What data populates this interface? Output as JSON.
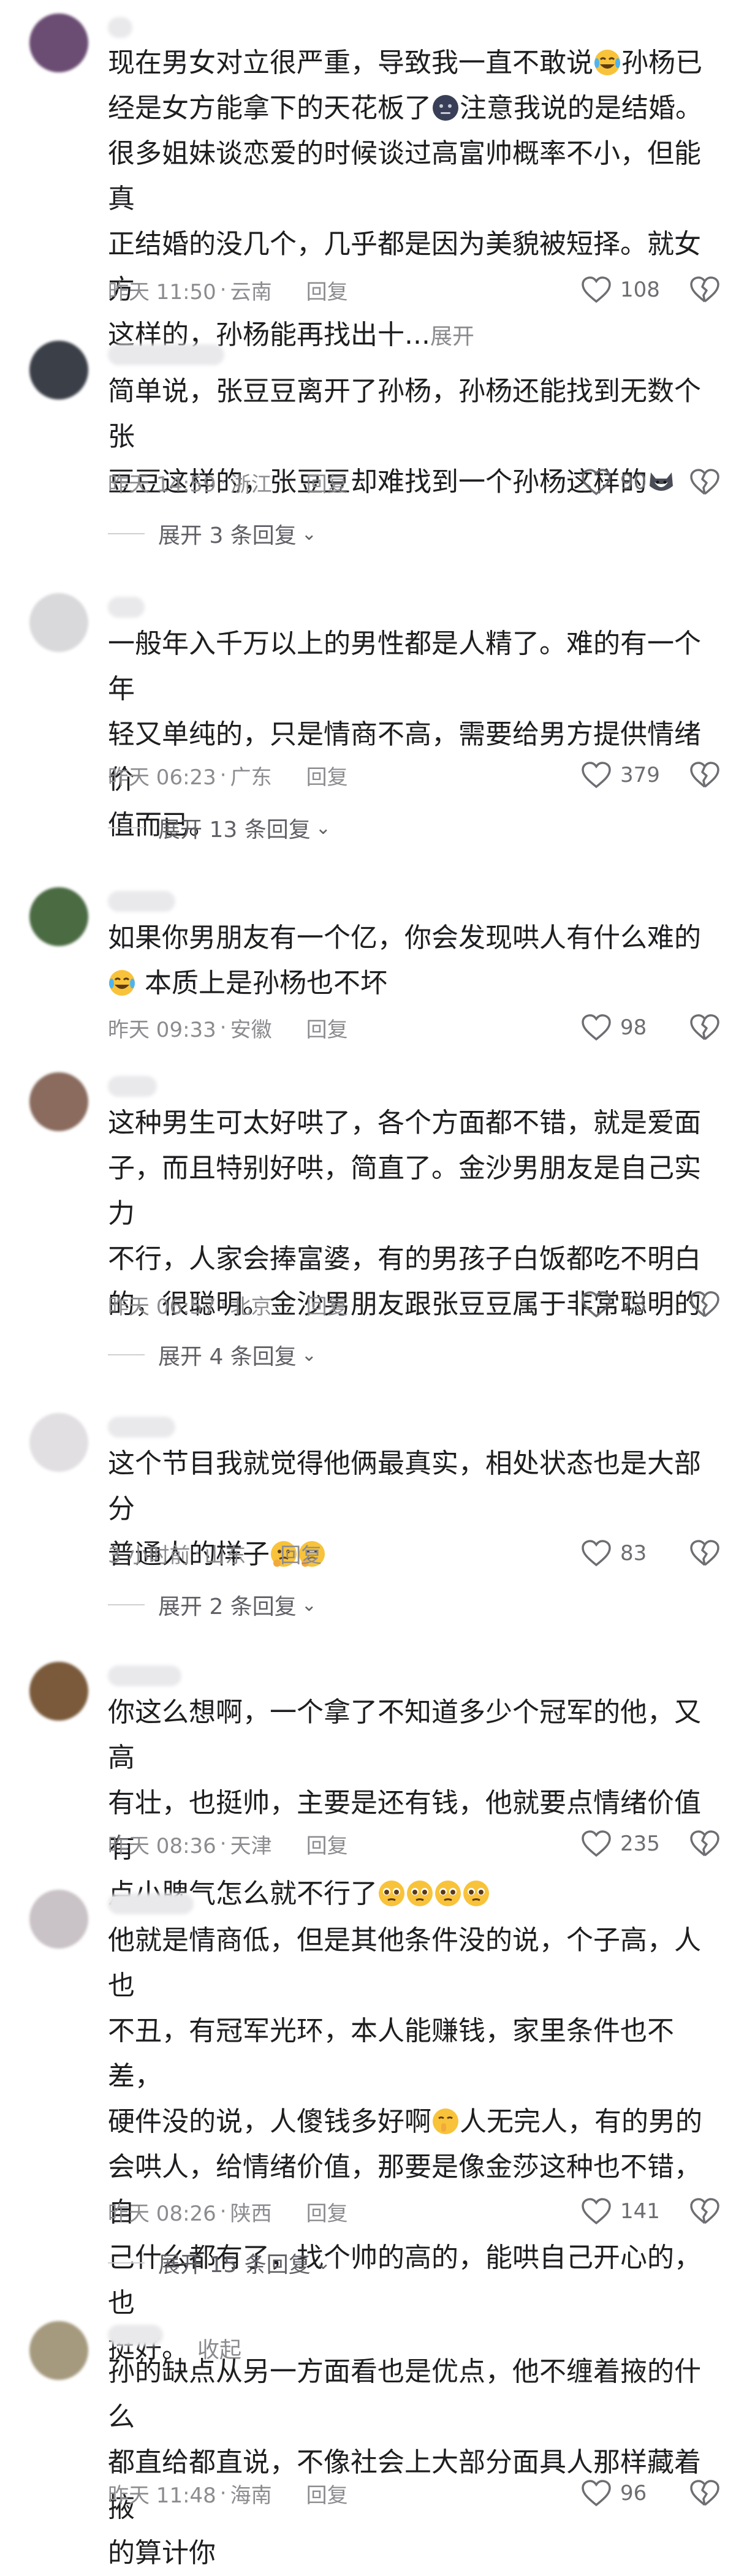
{
  "comments": [
    {
      "avatar_color": "#6b4c73",
      "text_lines": [
        "现在男女对立很严重，导致我一直不敢说",
        "孙杨已",
        "经是女方能拿下的天花板了",
        "注意我说的是结婚。",
        "很多姐妹谈恋爱的时候谈过高富帅概率不小，但能真",
        "正结婚的没几个，几乎都是因为美貌被短择。就女方",
        "这样的，孙杨能再找出十..."
      ],
      "more_label": "展开",
      "time": "昨天 11:50",
      "location": "云南",
      "reply_label": "回复",
      "likes": "108"
    },
    {
      "avatar_color": "#3b3f48",
      "text_lines": [
        "简单说，张豆豆离开了孙杨，孙杨还能找到无数个张",
        "豆豆这样的，张豆豆却难找到一个孙杨这样的"
      ],
      "time": "昨天 14:59",
      "location": "浙江",
      "reply_label": "回复",
      "likes": "90",
      "expand_label": "展开 3 条回复"
    },
    {
      "avatar_color": "#d9d9dc",
      "text_lines": [
        "一般年入千万以上的男性都是人精了。难的有一个年",
        "轻又单纯的，只是情商不高，需要给男方提供情绪价",
        "值而已。"
      ],
      "time": "昨天 06:23",
      "location": "广东",
      "reply_label": "回复",
      "likes": "379",
      "expand_label": "展开 13 条回复"
    },
    {
      "avatar_color": "#4b6b43",
      "text_lines": [
        "如果你男朋友有一个亿，你会发现哄人有什么难的",
        "本质上是孙杨也不坏"
      ],
      "time": "昨天 09:33",
      "location": "安徽",
      "reply_label": "回复",
      "likes": "98"
    },
    {
      "avatar_color": "#8a6b5e",
      "text_lines": [
        "这种男生可太好哄了，各个方面都不错，就是爱面",
        "子，而且特别好哄，简直了。金沙男朋友是自己实力",
        "不行，人家会捧富婆，有的男孩子白饭都吃不明白",
        "的，很聪明。金沙男朋友跟张豆豆属于非常聪明的"
      ],
      "time": "昨天 06:57",
      "location": "北京",
      "reply_label": "回复",
      "likes": "73",
      "expand_label": "展开 4 条回复"
    },
    {
      "avatar_color": "#e2dfe2",
      "text_lines": [
        "这个节目我就觉得他俩最真实，相处状态也是大部分",
        "普通人的样子"
      ],
      "time": "3 小时前",
      "location": "山东",
      "reply_label": "回复",
      "likes": "83",
      "expand_label": "展开 2 条回复"
    },
    {
      "avatar_color": "#7a5a3a",
      "text_lines": [
        "你这么想啊，一个拿了不知道多少个冠军的他，又高",
        "有壮，也挺帅，主要是还有钱，他就要点情绪价值有",
        "点小脾气怎么就不行了"
      ],
      "time": "昨天 08:36",
      "location": "天津",
      "reply_label": "回复",
      "likes": "235"
    },
    {
      "avatar_color": "#c9c2c6",
      "text_lines": [
        "他就是情商低，但是其他条件没的说，个子高，人也",
        "不丑，有冠军光环，本人能赚钱，家里条件也不差，",
        "硬件没的说，人傻钱多好啊",
        "人无完人，有的男的",
        "会哄人，给情绪价值，那要是像金莎这种也不错，自",
        "己什么都有了，找个帅的高的，能哄自己开心的，也",
        "挺好。"
      ],
      "collapse_label": "收起",
      "time": "昨天 08:26",
      "location": "陕西",
      "reply_label": "回复",
      "likes": "141",
      "expand_label": "展开 15 条回复"
    },
    {
      "avatar_color": "#a59a7e",
      "text_lines": [
        "孙的缺点从另一方面看也是优点，他不缠着掖的什么",
        "都直给都直说，不像社会上大部分面具人那样藏着掖",
        "的算计你"
      ],
      "time": "昨天 11:48",
      "location": "海南",
      "reply_label": "回复",
      "likes": "96"
    }
  ]
}
